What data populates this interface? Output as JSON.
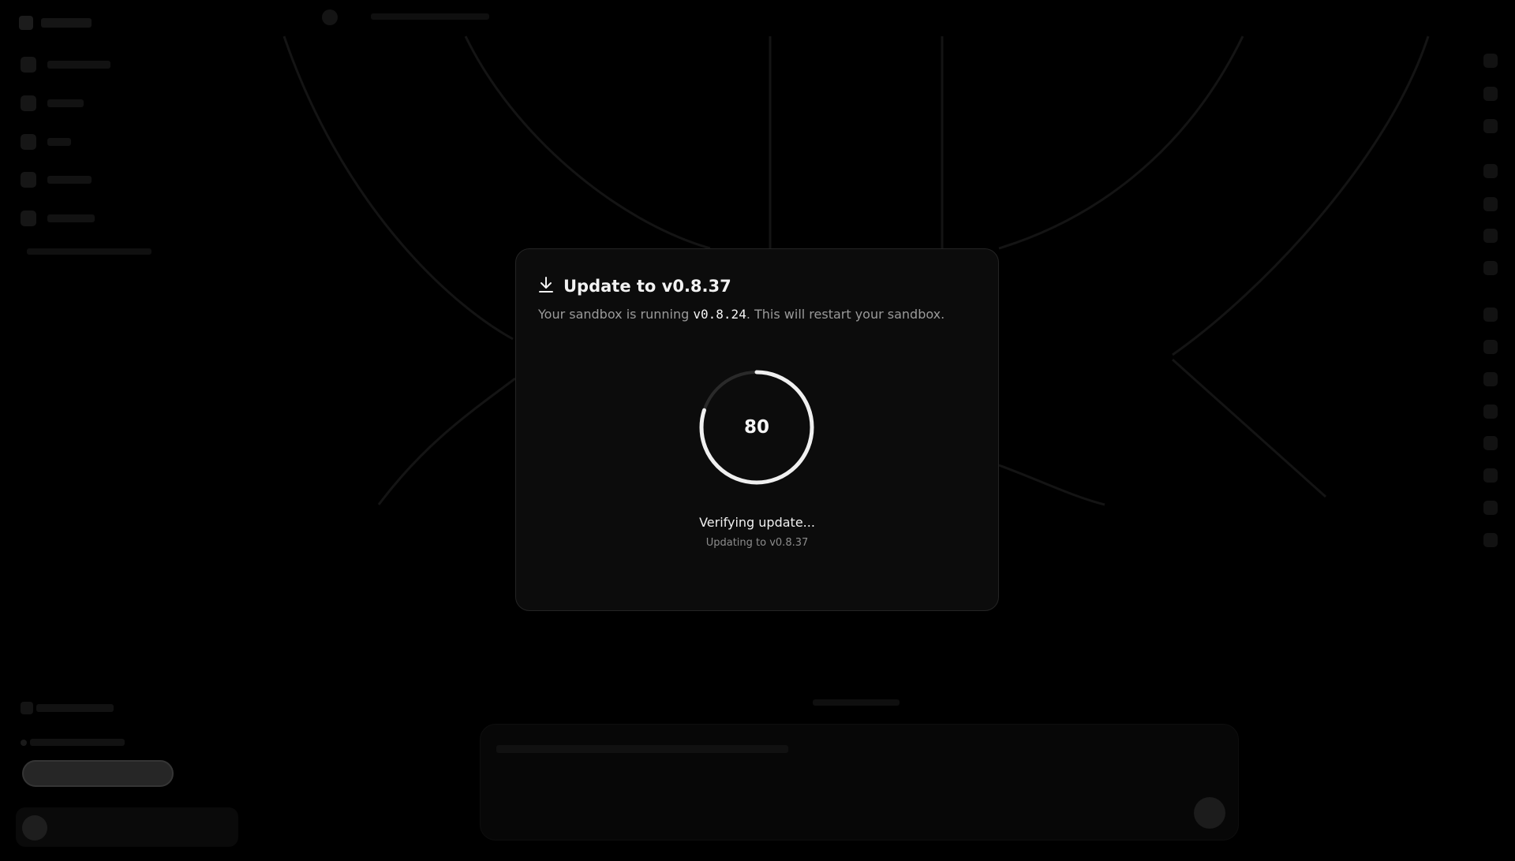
{
  "modal": {
    "title": "Update to v0.8.37",
    "subtitle_prefix": "Your sandbox is running ",
    "current_version": "v0.8.24",
    "subtitle_suffix": ". This will restart your sandbox.",
    "progress_value": "80",
    "progress_fraction": 0.8,
    "status": "Verifying update...",
    "status_sub": "Updating to v0.8.37",
    "icon": "download-icon"
  }
}
